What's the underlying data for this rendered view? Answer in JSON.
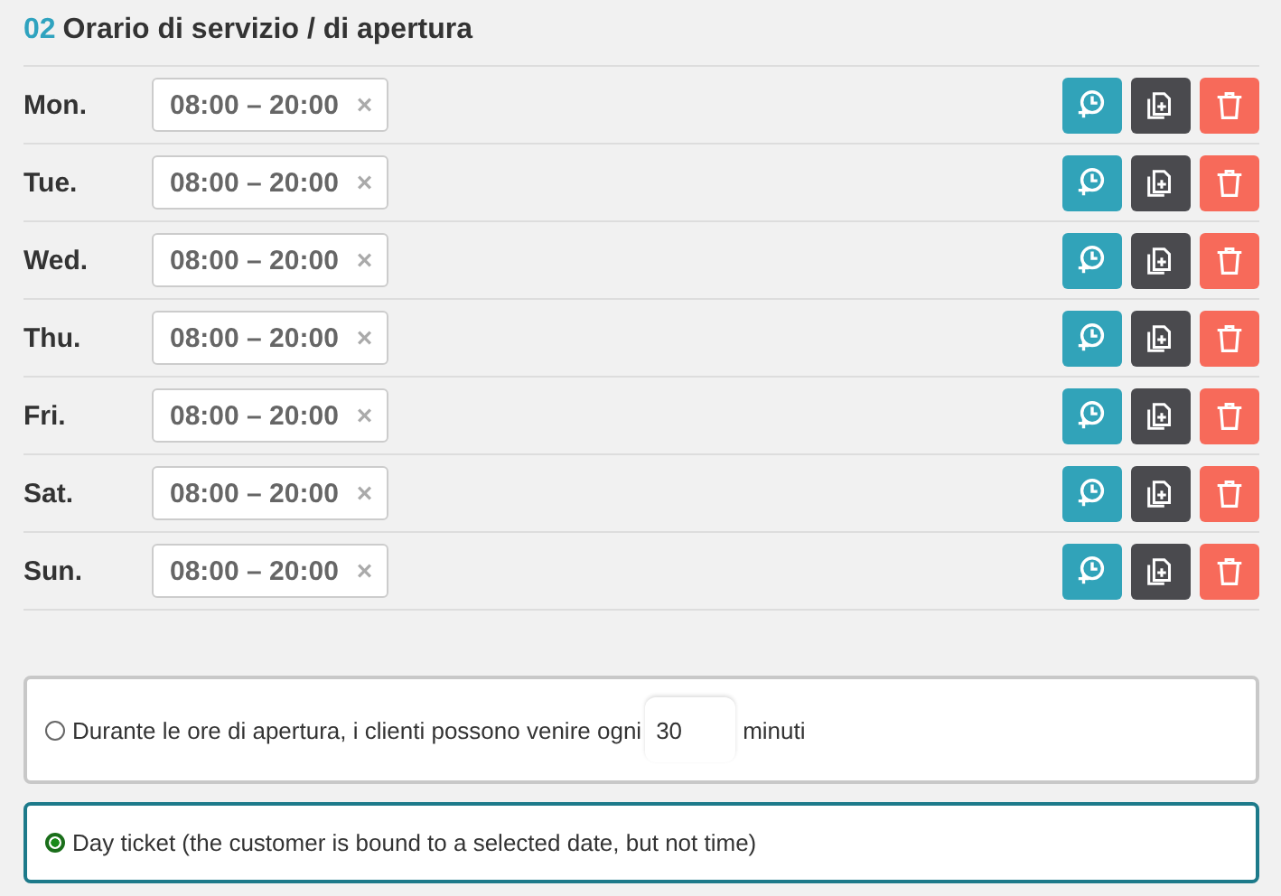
{
  "section": {
    "number": "02",
    "title": "Orario di servizio / di apertura"
  },
  "days": [
    {
      "label": "Mon.",
      "range": "08:00 – 20:00",
      "remove": "×"
    },
    {
      "label": "Tue.",
      "range": "08:00 – 20:00",
      "remove": "×"
    },
    {
      "label": "Wed.",
      "range": "08:00 – 20:00",
      "remove": "×"
    },
    {
      "label": "Thu.",
      "range": "08:00 – 20:00",
      "remove": "×"
    },
    {
      "label": "Fri.",
      "range": "08:00 – 20:00",
      "remove": "×"
    },
    {
      "label": "Sat.",
      "range": "08:00 – 20:00",
      "remove": "×"
    },
    {
      "label": "Sun.",
      "range": "08:00 – 20:00",
      "remove": "×"
    }
  ],
  "options": [
    {
      "kind": "interval",
      "selected": false,
      "text": "Durante le ore di apertura, i clienti possono venire ogni",
      "value": "30",
      "unit": "minuti"
    },
    {
      "kind": "plain",
      "selected": true,
      "text": "Day ticket (the customer is bound to a selected date, but not time)"
    }
  ]
}
